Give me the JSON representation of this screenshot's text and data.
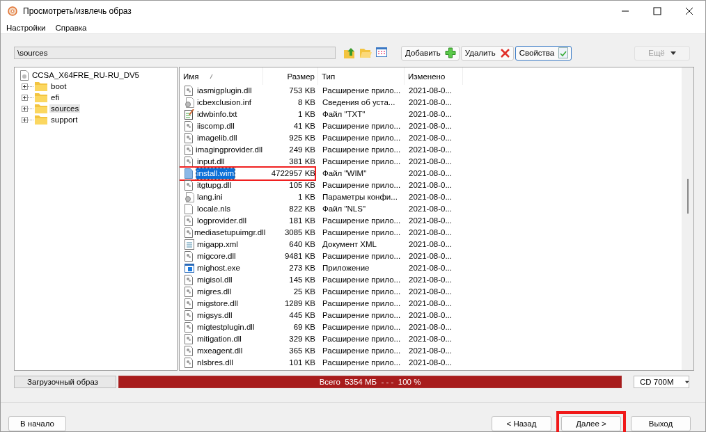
{
  "window": {
    "title": "Просмотреть/извлечь образ"
  },
  "menu": [
    "Настройки",
    "Справка"
  ],
  "path_field": {
    "value": "\\sources"
  },
  "toolbar": [
    {
      "label": "Добавить",
      "kind": "add"
    },
    {
      "label": "Удалить",
      "kind": "delete"
    },
    {
      "label": "Свойства",
      "kind": "properties"
    }
  ],
  "more_button": {
    "label": "Ещё",
    "disabled": true
  },
  "tree": {
    "label": "CCSA_X64FRE_RU-RU_DV5",
    "children": [
      {
        "label": "boot",
        "expanded": false,
        "selected": false
      },
      {
        "label": "efi",
        "expanded": false,
        "selected": false
      },
      {
        "label": "sources",
        "expanded": false,
        "selected": true
      },
      {
        "label": "support",
        "expanded": false,
        "selected": false
      }
    ]
  },
  "table": {
    "columns": [
      "Имя",
      "Размер",
      "Тип",
      "Изменено"
    ],
    "rows": [
      {
        "name": "iasmigplugin.dll",
        "size": "753 KB",
        "type": "Расширение прило...",
        "modified": "2021-08-0...",
        "kind": "dll",
        "selected": false,
        "annotated": false
      },
      {
        "name": "icbexclusion.inf",
        "size": "8 KB",
        "type": "Сведения об уста...",
        "modified": "2021-08-0...",
        "kind": "inf",
        "selected": false,
        "annotated": false
      },
      {
        "name": "idwbinfo.txt",
        "size": "1 KB",
        "type": "Файл \"TXT\"",
        "modified": "2021-08-0...",
        "kind": "txt",
        "selected": false,
        "annotated": false
      },
      {
        "name": "iiscomp.dll",
        "size": "41 KB",
        "type": "Расширение прило...",
        "modified": "2021-08-0...",
        "kind": "dll",
        "selected": false,
        "annotated": false
      },
      {
        "name": "imagelib.dll",
        "size": "925 KB",
        "type": "Расширение прило...",
        "modified": "2021-08-0...",
        "kind": "dll",
        "selected": false,
        "annotated": false
      },
      {
        "name": "imagingprovider.dll",
        "size": "249 KB",
        "type": "Расширение прило...",
        "modified": "2021-08-0...",
        "kind": "dll",
        "selected": false,
        "annotated": false
      },
      {
        "name": "input.dll",
        "size": "381 KB",
        "type": "Расширение прило...",
        "modified": "2021-08-0...",
        "kind": "dll",
        "selected": false,
        "annotated": false
      },
      {
        "name": "install.wim",
        "size": "4722957 KB",
        "type": "Файл \"WIM\"",
        "modified": "2021-08-0...",
        "kind": "wim",
        "selected": true,
        "annotated": true
      },
      {
        "name": "itgtupg.dll",
        "size": "105 KB",
        "type": "Расширение прило...",
        "modified": "2021-08-0...",
        "kind": "dll",
        "selected": false,
        "annotated": false
      },
      {
        "name": "lang.ini",
        "size": "1 KB",
        "type": "Параметры конфи...",
        "modified": "2021-08-0...",
        "kind": "ini",
        "selected": false,
        "annotated": false
      },
      {
        "name": "locale.nls",
        "size": "822 KB",
        "type": "Файл \"NLS\"",
        "modified": "2021-08-0...",
        "kind": "nls",
        "selected": false,
        "annotated": false
      },
      {
        "name": "logprovider.dll",
        "size": "181 KB",
        "type": "Расширение прило...",
        "modified": "2021-08-0...",
        "kind": "dll",
        "selected": false,
        "annotated": false
      },
      {
        "name": "mediasetupuimgr.dll",
        "size": "3085 KB",
        "type": "Расширение прило...",
        "modified": "2021-08-0...",
        "kind": "dll",
        "selected": false,
        "annotated": false
      },
      {
        "name": "migapp.xml",
        "size": "640 KB",
        "type": "Документ XML",
        "modified": "2021-08-0...",
        "kind": "xml",
        "selected": false,
        "annotated": false
      },
      {
        "name": "migcore.dll",
        "size": "9481 KB",
        "type": "Расширение прило...",
        "modified": "2021-08-0...",
        "kind": "dll",
        "selected": false,
        "annotated": false
      },
      {
        "name": "mighost.exe",
        "size": "273 KB",
        "type": "Приложение",
        "modified": "2021-08-0...",
        "kind": "exe",
        "selected": false,
        "annotated": false
      },
      {
        "name": "migisol.dll",
        "size": "145 KB",
        "type": "Расширение прило...",
        "modified": "2021-08-0...",
        "kind": "dll",
        "selected": false,
        "annotated": false
      },
      {
        "name": "migres.dll",
        "size": "25 KB",
        "type": "Расширение прило...",
        "modified": "2021-08-0...",
        "kind": "dll",
        "selected": false,
        "annotated": false
      },
      {
        "name": "migstore.dll",
        "size": "1289 KB",
        "type": "Расширение прило...",
        "modified": "2021-08-0...",
        "kind": "dll",
        "selected": false,
        "annotated": false
      },
      {
        "name": "migsys.dll",
        "size": "445 KB",
        "type": "Расширение прило...",
        "modified": "2021-08-0...",
        "kind": "dll",
        "selected": false,
        "annotated": false
      },
      {
        "name": "migtestplugin.dll",
        "size": "69 KB",
        "type": "Расширение прило...",
        "modified": "2021-08-0...",
        "kind": "dll",
        "selected": false,
        "annotated": false
      },
      {
        "name": "mitigation.dll",
        "size": "329 KB",
        "type": "Расширение прило...",
        "modified": "2021-08-0...",
        "kind": "dll",
        "selected": false,
        "annotated": false
      },
      {
        "name": "mxeagent.dll",
        "size": "365 KB",
        "type": "Расширение прило...",
        "modified": "2021-08-0...",
        "kind": "dll",
        "selected": false,
        "annotated": false
      },
      {
        "name": "nlsbres.dll",
        "size": "101 KB",
        "type": "Расширение прило...",
        "modified": "2021-08-0...",
        "kind": "dll",
        "selected": false,
        "annotated": false
      }
    ]
  },
  "status": {
    "label": "Загрузочный образ",
    "usage": "Всего  5354 МБ  - - -  100 %",
    "level": 1,
    "media": "CD 700M"
  },
  "buttons": [
    {
      "label": "В начало",
      "kind": "start",
      "annotated": false
    },
    {
      "label": "< Назад",
      "kind": "back",
      "annotated": false
    },
    {
      "label": "Далее >",
      "kind": "next",
      "annotated": true
    },
    {
      "label": "Выход",
      "kind": "exit",
      "annotated": false
    }
  ]
}
